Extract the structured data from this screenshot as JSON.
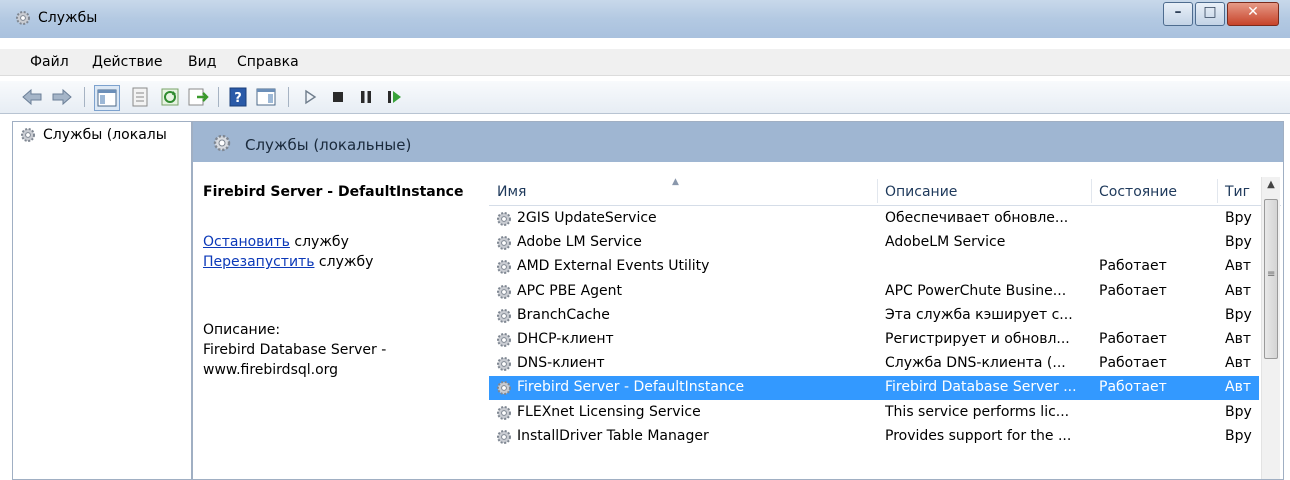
{
  "window": {
    "title": "Службы"
  },
  "menu": [
    "Файл",
    "Действие",
    "Вид",
    "Справка"
  ],
  "left_pane": {
    "item": "Службы (локалы"
  },
  "right_pane": {
    "title": "Службы (локальные)",
    "selected_service": "Firebird Server - DefaultInstance",
    "action_stop_link": "Остановить",
    "action_stop_suffix": " службу",
    "action_restart_link": "Перезапустить",
    "action_restart_suffix": " службу",
    "desc_label": "Описание:",
    "desc_text": "Firebird Database Server - www.firebirdsql.org"
  },
  "columns": [
    "Имя",
    "Описание",
    "Состояние",
    "Тиг"
  ],
  "rows": [
    {
      "name": "2GIS UpdateService",
      "desc": "Обеспечивает обновле...",
      "state": "",
      "type": "Вру"
    },
    {
      "name": "Adobe LM Service",
      "desc": "AdobeLM Service",
      "state": "",
      "type": "Вру"
    },
    {
      "name": "AMD External Events Utility",
      "desc": "",
      "state": "Работает",
      "type": "Авт"
    },
    {
      "name": "APC PBE Agent",
      "desc": "APC PowerChute Busine...",
      "state": "Работает",
      "type": "Авт"
    },
    {
      "name": "BranchCache",
      "desc": "Эта служба кэширует с...",
      "state": "",
      "type": "Вру"
    },
    {
      "name": "DHCP-клиент",
      "desc": "Регистрирует и обновл...",
      "state": "Работает",
      "type": "Авт"
    },
    {
      "name": "DNS-клиент",
      "desc": "Служба DNS-клиента (...",
      "state": "Работает",
      "type": "Авт"
    },
    {
      "name": "Firebird Server - DefaultInstance",
      "desc": "Firebird Database Server ...",
      "state": "Работает",
      "type": "Авт",
      "selected": true
    },
    {
      "name": "FLEXnet Licensing Service",
      "desc": "This service performs lic...",
      "state": "",
      "type": "Вру"
    },
    {
      "name": "InstallDriver Table Manager",
      "desc": "Provides support for the ...",
      "state": "",
      "type": "Вру"
    }
  ],
  "colors": {
    "selection": "#3399ff",
    "link": "#0c39b8",
    "header_band": "#9fb6d2"
  }
}
